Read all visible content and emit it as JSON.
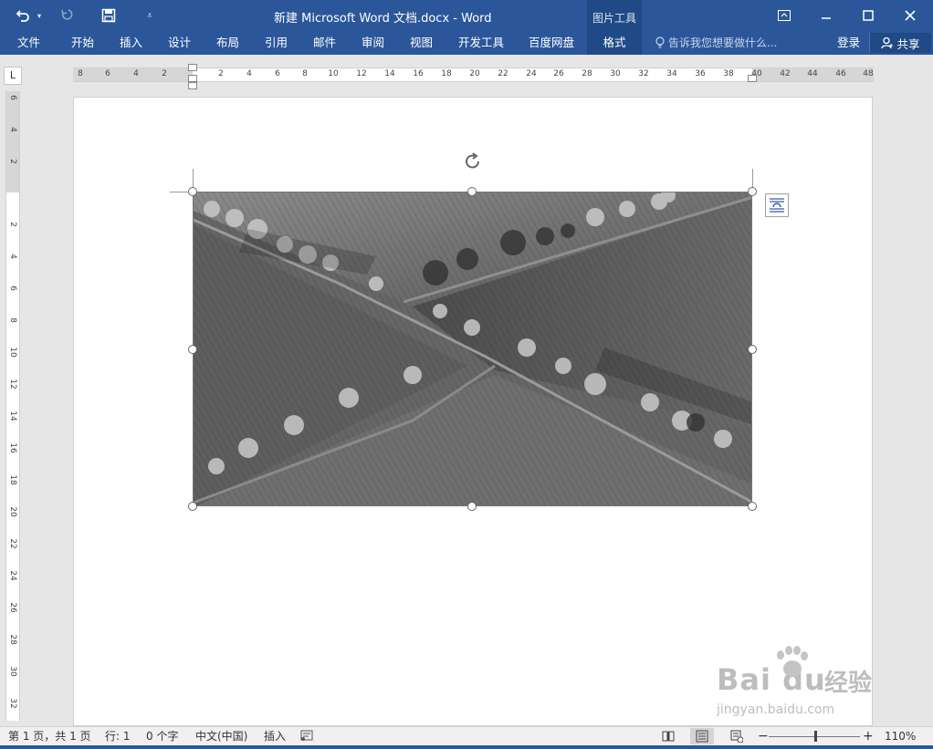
{
  "window": {
    "title": "新建 Microsoft Word 文档.docx - Word",
    "context_tab_group": "图片工具",
    "controls": [
      "restore-ribbon",
      "minimize",
      "maximize",
      "close"
    ]
  },
  "ribbon": {
    "tabs": [
      {
        "label": "文件"
      },
      {
        "label": "开始"
      },
      {
        "label": "插入"
      },
      {
        "label": "设计"
      },
      {
        "label": "布局"
      },
      {
        "label": "引用"
      },
      {
        "label": "邮件"
      },
      {
        "label": "审阅"
      },
      {
        "label": "视图"
      },
      {
        "label": "开发工具"
      },
      {
        "label": "百度网盘"
      }
    ],
    "format_tab": "格式",
    "tell_me": "告诉我您想要做什么...",
    "login": "登录",
    "share": "共享"
  },
  "ruler": {
    "corner": "L",
    "horizontal": [
      "8",
      "6",
      "4",
      "2",
      "2",
      "4",
      "6",
      "8",
      "10",
      "12",
      "14",
      "16",
      "18",
      "20",
      "22",
      "24",
      "26",
      "28",
      "30",
      "32",
      "34",
      "36",
      "38",
      "40",
      "42",
      "44",
      "46",
      "48"
    ],
    "vertical": [
      "6",
      "4",
      "2",
      "2",
      "4",
      "6",
      "8",
      "10",
      "12",
      "14",
      "16",
      "18",
      "20",
      "22",
      "24",
      "26",
      "28",
      "30",
      "32"
    ]
  },
  "watermark": {
    "logo": "Bai du",
    "brand": "经验",
    "url": "jingyan.baidu.com"
  },
  "status": {
    "page": "第 1 页，共 1 页",
    "line": "行: 1",
    "words": "0 个字",
    "language": "中文(中国)",
    "mode": "插入",
    "zoom": "110%"
  },
  "colors": {
    "accent": "#2b579a",
    "context_tab": "#1f4a85"
  }
}
